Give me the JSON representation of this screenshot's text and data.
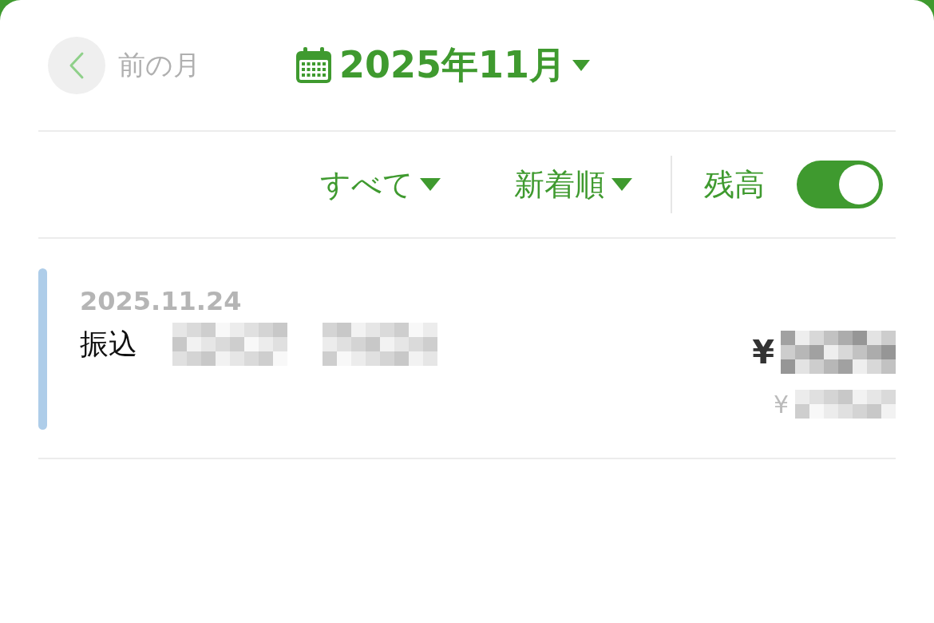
{
  "header": {
    "prev_label": "前の月",
    "month": "2025年11月"
  },
  "filters": [
    {
      "label": "すべて"
    },
    {
      "label": "新着順"
    }
  ],
  "balance_toggle": {
    "label": "残高",
    "on": true
  },
  "transactions": [
    {
      "date": "2025.11.24",
      "description": "振込",
      "amount_symbol": "¥",
      "balance_symbol": "¥",
      "color": "#aecde9"
    }
  ]
}
